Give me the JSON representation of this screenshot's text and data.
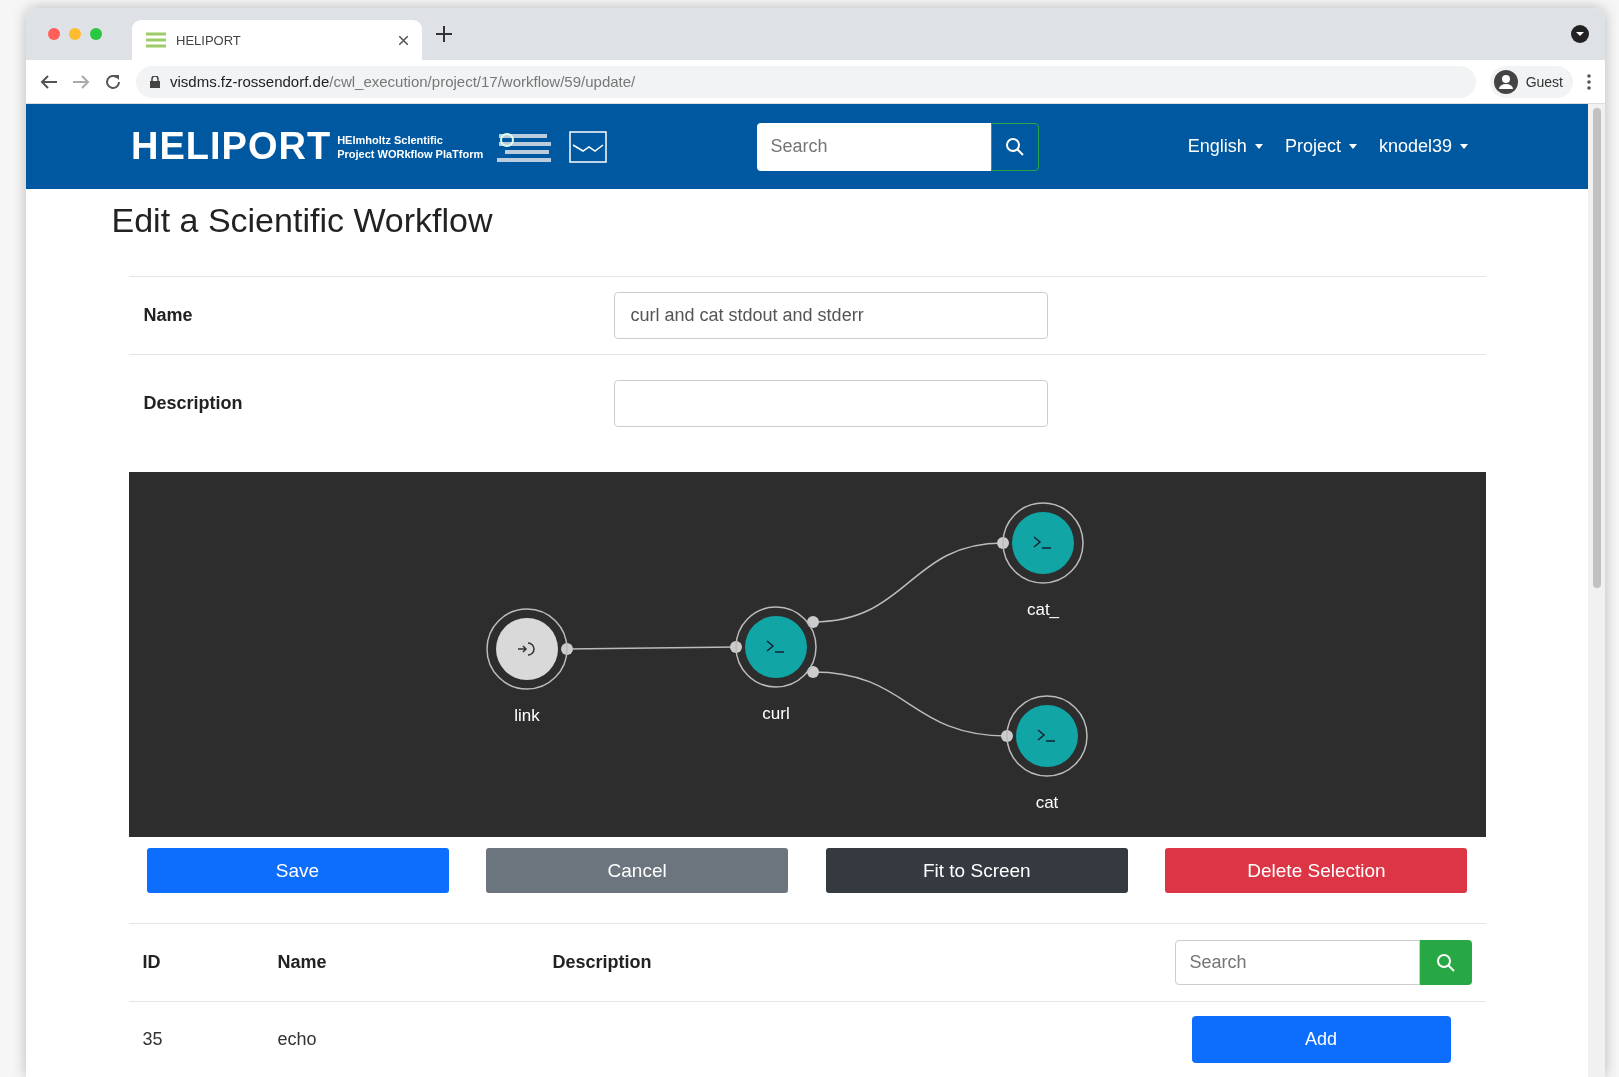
{
  "browser": {
    "tab_title": "HELIPORT",
    "url_domain": "visdms.fz-rossendorf.de",
    "url_path": "/cwl_execution/project/17/workflow/59/update/",
    "profile": "Guest"
  },
  "navbar": {
    "brand": "HELIPORT",
    "tagline": [
      "**HE**lmholtz Sc**I**entific",
      "**P**roject W**OR**kflow Pla**T**form"
    ],
    "search": {
      "placeholder": "Search"
    },
    "menus": [
      "English",
      "Project",
      "knodel39"
    ]
  },
  "page_title": "Edit a Scientific Workflow",
  "form": [
    {
      "label": "Name",
      "kind": "input",
      "value": "curl and cat stdout and stderr"
    },
    {
      "label": "Description",
      "kind": "textarea"
    }
  ],
  "workflow": {
    "nodes": [
      {
        "label": "link",
        "kind": "input"
      },
      {
        "label": "curl",
        "kind": "tool"
      },
      {
        "label": "cat_",
        "kind": "tool"
      },
      {
        "label": "cat",
        "kind": "tool"
      }
    ]
  },
  "buttons": [
    {
      "label": "Save",
      "kind": "primary"
    },
    {
      "label": "Cancel",
      "kind": "secondary"
    },
    {
      "label": "Fit to Screen",
      "kind": "dark"
    },
    {
      "label": "Delete Selection",
      "kind": "danger"
    }
  ],
  "table": {
    "columns": [
      "ID",
      "Name",
      "Description"
    ],
    "search": {
      "placeholder": "Search"
    },
    "rows": [
      {
        "id": "35",
        "name": "echo",
        "action": "Add"
      }
    ]
  }
}
